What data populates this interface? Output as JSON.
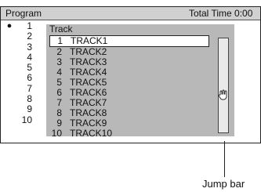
{
  "header": {
    "title": "Program",
    "total_time": "Total Time 0:00"
  },
  "program": {
    "marker": "●",
    "items": [
      "1",
      "2",
      "3",
      "4",
      "5",
      "6",
      "7",
      "8",
      "9",
      "10"
    ]
  },
  "track_panel": {
    "heading": "Track",
    "selected_index": 0,
    "items": [
      {
        "num": "1",
        "name": "TRACK1"
      },
      {
        "num": "2",
        "name": "TRACK2"
      },
      {
        "num": "3",
        "name": "TRACK3"
      },
      {
        "num": "4",
        "name": "TRACK4"
      },
      {
        "num": "5",
        "name": "TRACK5"
      },
      {
        "num": "6",
        "name": "TRACK6"
      },
      {
        "num": "7",
        "name": "TRACK7"
      },
      {
        "num": "8",
        "name": "TRACK8"
      },
      {
        "num": "9",
        "name": "TRACK9"
      },
      {
        "num": "10",
        "name": "TRACK10"
      }
    ]
  },
  "jump_bar": {
    "icon": "hand-pointer-icon"
  },
  "annotation": {
    "label": "Jump bar"
  }
}
